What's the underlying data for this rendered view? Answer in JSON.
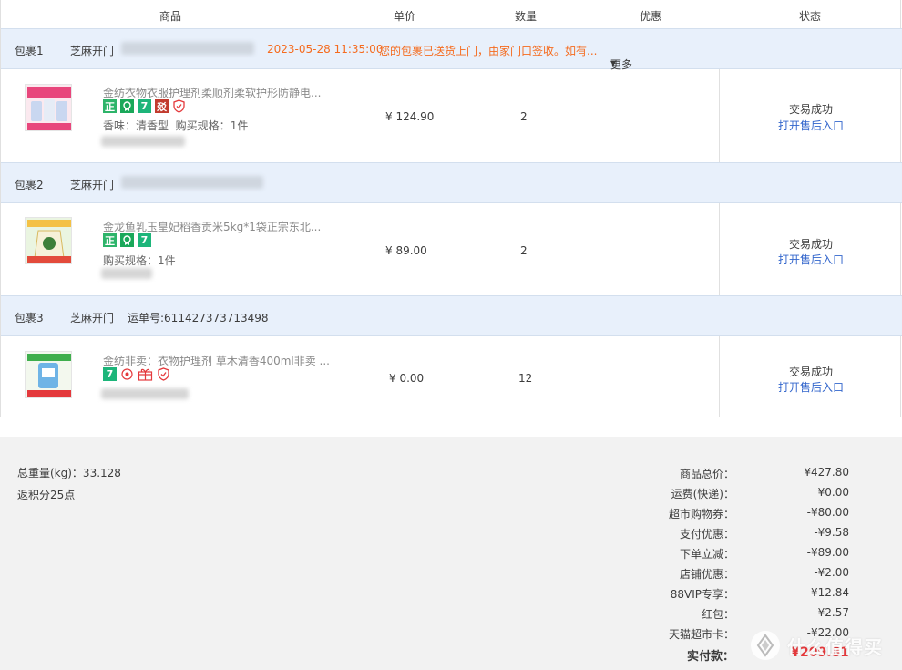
{
  "header": {
    "col_product": "商品",
    "col_price": "单价",
    "col_qty": "数量",
    "col_discount": "优惠",
    "col_status": "状态"
  },
  "packages": [
    {
      "label": "包裹1",
      "carrier": "芝麻开门",
      "time": "2023-05-28 11:35:00",
      "notice": "您的包裹已送货上门，由家门口签收。如有...",
      "more": "更多",
      "item": {
        "title": "金纺衣物衣服护理剂柔顺剂柔软护形防静电...",
        "spec_label1": "香味：",
        "spec_value1": "清香型",
        "spec_label2": "购买规格：",
        "spec_value2": "1件",
        "price": "¥ 124.90",
        "qty": "2",
        "status": "交易成功",
        "link": "打开售后入口"
      }
    },
    {
      "label": "包裹2",
      "carrier": "芝麻开门",
      "item": {
        "title": "金龙鱼乳玉皇妃稻香贡米5kg*1袋正宗东北...",
        "spec_label1": "购买规格：",
        "spec_value1": "1件",
        "price": "¥ 89.00",
        "qty": "2",
        "status": "交易成功",
        "link": "打开售后入口"
      }
    },
    {
      "label": "包裹3",
      "carrier": "芝麻开门",
      "waybill": "运单号:611427373713498",
      "item": {
        "title": "金纺非卖：衣物护理剂 草木清香400ml非卖 ...",
        "price": "¥ 0.00",
        "qty": "12",
        "status": "交易成功",
        "link": "打开售后入口"
      }
    }
  ],
  "summary": {
    "weight": "总重量(kg)：33.128",
    "points": "返积分25点",
    "rows": [
      {
        "label": "商品总价：",
        "value": "¥427.80"
      },
      {
        "label": "运费(快递)：",
        "value": "¥0.00"
      },
      {
        "label": "超市购物券：",
        "value": "-¥80.00"
      },
      {
        "label": "支付优惠：",
        "value": "-¥9.58"
      },
      {
        "label": "下单立减：",
        "value": "-¥89.00"
      },
      {
        "label": "店铺优惠：",
        "value": "-¥2.00"
      },
      {
        "label": "88VIP专享：",
        "value": "-¥12.84"
      },
      {
        "label": "红包：",
        "value": "-¥2.57"
      },
      {
        "label": "天猫超市卡：",
        "value": "-¥22.00"
      }
    ],
    "total_label": "实付款：",
    "total_value": "¥209.81"
  },
  "badges": {
    "zheng": "正",
    "seven": "7",
    "mark": "㸚"
  },
  "watermark": {
    "text": "什么值得买",
    "icon": "smzdm-logo-icon"
  },
  "colors": {
    "package_bar": "#e8f0fb",
    "notice": "#f56b1e",
    "link": "#3366cc",
    "total": "#e4393c",
    "summary_bg": "#f2f2f2"
  }
}
